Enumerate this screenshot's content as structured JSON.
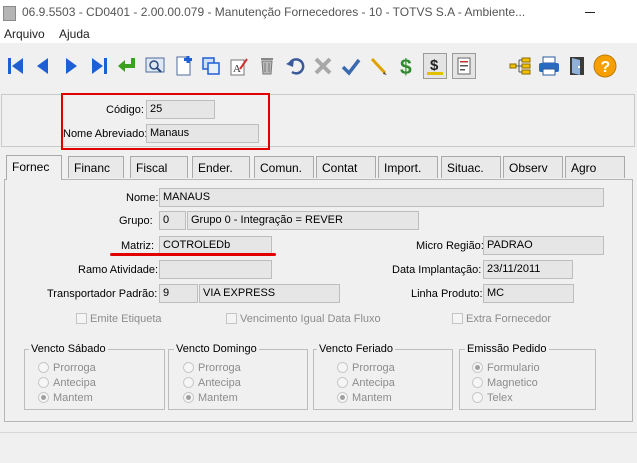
{
  "window": {
    "title": "06.9.5503 - CD0401 - 2.00.00.079 - Manutenção Fornecedores - 10 - TOTVS S.A - Ambiente..."
  },
  "menu": {
    "items": [
      "Arquivo",
      "Ajuda"
    ]
  },
  "toolbar": {
    "icons": [
      "first-record-icon",
      "previous-record-icon",
      "next-record-icon",
      "last-record-icon",
      "go-to-icon",
      "search-icon",
      "add-icon",
      "copy-icon",
      "edit-icon",
      "delete-icon",
      "undo-icon",
      "cancel-icon",
      "confirm-icon",
      "pencil-icon",
      "dollar-icon",
      "currency-icon",
      "report-icon",
      "tree-icon",
      "print-icon",
      "exit-icon",
      "help-icon"
    ]
  },
  "header": {
    "codigo_label": "Código:",
    "codigo_value": "25",
    "nome_abrev_label": "Nome Abreviado:",
    "nome_abrev_value": "Manaus"
  },
  "tabs": [
    "Fornec",
    "Financ",
    "Fiscal",
    "Ender.",
    "Comun.",
    "Contat",
    "Import.",
    "Situac.",
    "Observ",
    "Agro"
  ],
  "active_tab": "Fornec",
  "form": {
    "nome_label": "Nome:",
    "nome_value": "MANAUS",
    "grupo_label": "Grupo:",
    "grupo_code": "0",
    "grupo_desc": "Grupo 0 - Integração = REVER",
    "matriz_label": "Matriz:",
    "matriz_value": "COTROLEDb",
    "micro_regiao_label": "Micro Região:",
    "micro_regiao_value": "PADRAO",
    "ramo_label": "Ramo Atividade:",
    "ramo_value": "",
    "data_impl_label": "Data Implantação:",
    "data_impl_value": "23/11/2011",
    "transp_label": "Transportador Padrão:",
    "transp_code": "9",
    "transp_name": "VIA EXPRESS",
    "linha_label": "Linha Produto:",
    "linha_value": "MC",
    "emite_etiqueta": "Emite Etiqueta",
    "venc_igual": "Vencimento Igual Data Fluxo",
    "extra_fornecedor": "Extra Fornecedor"
  },
  "groups": {
    "sabado": {
      "title": "Vencto Sábado",
      "options": [
        "Prorroga",
        "Antecipa",
        "Mantem"
      ],
      "selected": "Mantem"
    },
    "domingo": {
      "title": "Vencto Domingo",
      "options": [
        "Prorroga",
        "Antecipa",
        "Mantem"
      ],
      "selected": "Mantem"
    },
    "feriado": {
      "title": "Vencto Feriado",
      "options": [
        "Prorroga",
        "Antecipa",
        "Mantem"
      ],
      "selected": "Mantem"
    },
    "emissao": {
      "title": "Emissão Pedido",
      "options": [
        "Formulario",
        "Magnetico",
        "Telex"
      ],
      "selected": "Formulario"
    }
  },
  "colors": {
    "accent_blue": "#1f5fd6",
    "highlight_red": "#e00000",
    "help_orange": "#f5a000"
  }
}
